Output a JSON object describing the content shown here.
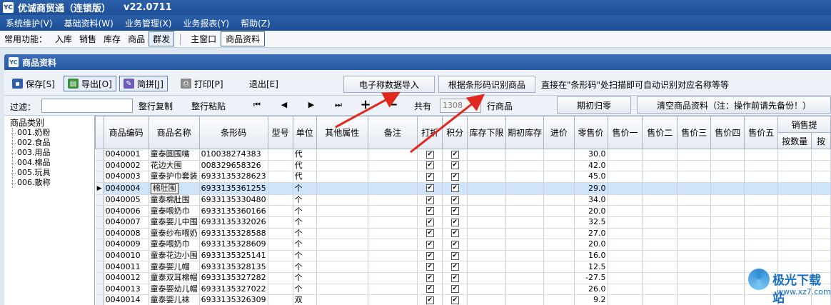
{
  "window": {
    "title": "优诚商贸通（连锁版）",
    "version": "v22.0711",
    "app_icon": "YC"
  },
  "menu": [
    "系统维护(V)",
    "基础资料(W)",
    "业务管理(X)",
    "业务报表(Y)",
    "帮助(Z)"
  ],
  "quickbar": {
    "label": "常用功能：",
    "items": [
      "入库",
      "销售",
      "库存",
      "商品",
      "群发"
    ],
    "tabs": [
      "主窗口",
      "商品资料"
    ]
  },
  "subwindow": {
    "title": "商品资料",
    "icon": "YC"
  },
  "toolbar": {
    "save": "保存[S]",
    "export": "导出[O]",
    "pinyin": "简拼[J]",
    "print": "打印[P]",
    "exit": "退出[E]",
    "scale_import": "电子称数据导入",
    "barcode_identify": "根据条形码识别商品",
    "hint": "直接在\"条形码\"处扫描即可自动识别对应名称等等"
  },
  "filterbar": {
    "filter_label": "过滤：",
    "filter_value": "",
    "copy_row": "整行复制",
    "paste_row": "整行粘贴",
    "nav_first": "⏮",
    "nav_prev": "◀",
    "nav_next": "▶",
    "nav_last": "⏭",
    "add": "+",
    "remove": "−",
    "count_label": "共有",
    "count_value": "1308",
    "count_unit": "行商品",
    "period_reset": "期初归零",
    "clear_data": "清空商品资料（注：操作前请先备份！）"
  },
  "tree": {
    "root": "商品类别",
    "nodes": [
      "001.奶粉",
      "002.食品",
      "003.用品",
      "004.棉品",
      "005.玩具",
      "006.散称"
    ]
  },
  "grid": {
    "columns": [
      "商品编码",
      "商品名称",
      "条形码",
      "型号",
      "单位",
      "其他属性",
      "备注",
      "打折",
      "积分",
      "库存下限",
      "期初库存",
      "进价",
      "零售价",
      "售价一",
      "售价二",
      "售价三",
      "售价四",
      "售价五"
    ],
    "group_header": "销售提",
    "sub_headers": [
      "按数量",
      "按"
    ],
    "selected_row": 3,
    "rows": [
      {
        "code": "0040001",
        "name": "童泰圆围嘴",
        "barcode": "010038274383",
        "unit": "代",
        "price": "30.0"
      },
      {
        "code": "0040002",
        "name": "花边大围",
        "barcode": "008329658326",
        "unit": "代",
        "price": "42.0"
      },
      {
        "code": "0040003",
        "name": "童泰护巾套装",
        "barcode": "6933135328623",
        "unit": "代",
        "price": "45.0"
      },
      {
        "code": "0040004",
        "name": "棉肚围",
        "barcode": "6933135361255",
        "unit": "个",
        "price": "29.0"
      },
      {
        "code": "0040005",
        "name": "童泰棉肚围",
        "barcode": "6933135330480",
        "unit": "个",
        "price": "34.0"
      },
      {
        "code": "0040006",
        "name": "童泰喂奶巾",
        "barcode": "6933135360166",
        "unit": "个",
        "price": "20.0"
      },
      {
        "code": "0040007",
        "name": "童泰婴儿中围",
        "barcode": "6933135332026",
        "unit": "个",
        "price": "32.5"
      },
      {
        "code": "0040008",
        "name": "童泰纱布喂奶",
        "barcode": "6933135328588",
        "unit": "个",
        "price": "27.0"
      },
      {
        "code": "0040009",
        "name": "童泰喂奶巾",
        "barcode": "6933135328609",
        "unit": "个",
        "price": "20.0"
      },
      {
        "code": "0040010",
        "name": "童泰花边小围",
        "barcode": "6933135325141",
        "unit": "个",
        "price": "16.0"
      },
      {
        "code": "0040011",
        "name": "童泰婴儿帽",
        "barcode": "6933135328135",
        "unit": "个",
        "price": "12.5"
      },
      {
        "code": "0040012",
        "name": "童泰双耳棉帽",
        "barcode": "6933135327282",
        "unit": "个",
        "price": "-27.5"
      },
      {
        "code": "0040013",
        "name": "童泰婴幼儿帽",
        "barcode": "6933135327022",
        "unit": "个",
        "price": "26.0"
      },
      {
        "code": "0040014",
        "name": "童泰婴儿袜",
        "barcode": "6933135326309",
        "unit": "双",
        "price": "9.2"
      }
    ]
  },
  "watermark": {
    "text": "极光下载站",
    "url": "www.xz7.com"
  },
  "colors": {
    "titlebar": "#1d4f97",
    "selection": "#cfe3fa",
    "arrow": "#e0281f"
  }
}
